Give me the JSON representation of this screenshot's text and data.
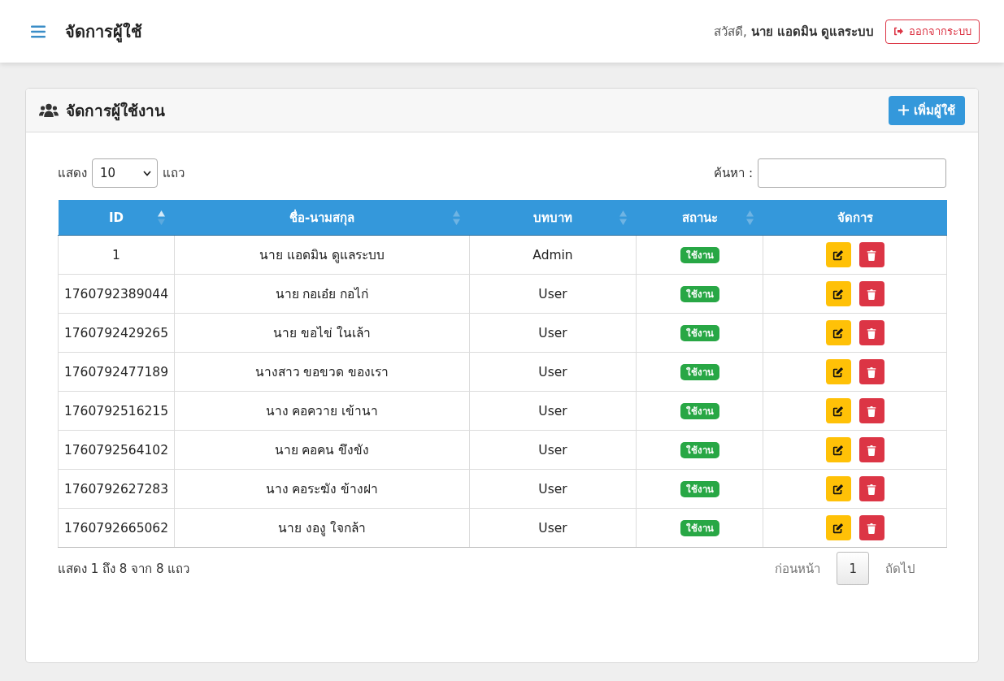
{
  "topbar": {
    "title": "จัดการผู้ใช้",
    "greeting": "สวัสดี, **นาย แอดมิน ดูแลระบบ**",
    "logout_button": "ออกจากระบบ"
  },
  "card": {
    "title": "จัดการผู้ใช้งาน",
    "add_button": "เพิ่มผู้ใช้"
  },
  "length_control": {
    "label_before": "แสดง",
    "value": "10",
    "label_after": "แถว"
  },
  "search": {
    "label": "ค้นหา :"
  },
  "table": {
    "columns": [
      {
        "label": "ID",
        "sortable": true,
        "sorted": true
      },
      {
        "label": "ชื่อ-นามสกุล",
        "sortable": true,
        "sorted": false
      },
      {
        "label": "บทบาท",
        "sortable": true,
        "sorted": false
      },
      {
        "label": "สถานะ",
        "sortable": true,
        "sorted": false
      },
      {
        "label": "จัดการ",
        "sortable": false
      }
    ],
    "rows": [
      {
        "id": "1",
        "name": "นาย แอดมิน ดูแลระบบ",
        "role": "Admin",
        "status": "ใช้งาน",
        "active": true
      },
      {
        "id": "1760792389044",
        "name": "นาย กอเอ๋ย กอไก่",
        "role": "User",
        "status": "ใช้งาน",
        "active": true
      },
      {
        "id": "1760792429265",
        "name": "นาย ขอไข่ ในเล้า",
        "role": "User",
        "status": "ใช้งาน",
        "active": true
      },
      {
        "id": "1760792477189",
        "name": "นางสาว ขอขวด ของเรา",
        "role": "User",
        "status": "ใช้งาน",
        "active": true
      },
      {
        "id": "1760792516215",
        "name": "นาง คอควาย เข้านา",
        "role": "User",
        "status": "ใช้งาน",
        "active": true
      },
      {
        "id": "1760792564102",
        "name": "นาย คอคน ขึงขัง",
        "role": "User",
        "status": "ใช้งาน",
        "active": true
      },
      {
        "id": "1760792627283",
        "name": "นาง คอระฆัง ข้างฝา",
        "role": "User",
        "status": "ใช้งาน",
        "active": true
      },
      {
        "id": "1760792665062",
        "name": "นาย งองู ใจกล้า",
        "role": "User",
        "status": "ใช้งาน",
        "active": true
      }
    ]
  },
  "info": "แสดง 1 ถึง 8 จาก 8 แถว",
  "pagination": {
    "previous": {
      "label": "ก่อนหน้า",
      "disabled": true
    },
    "pages": [
      {
        "label": "1",
        "selected": true
      }
    ],
    "next": {
      "label": "ถัดไป",
      "disabled": true
    }
  }
}
